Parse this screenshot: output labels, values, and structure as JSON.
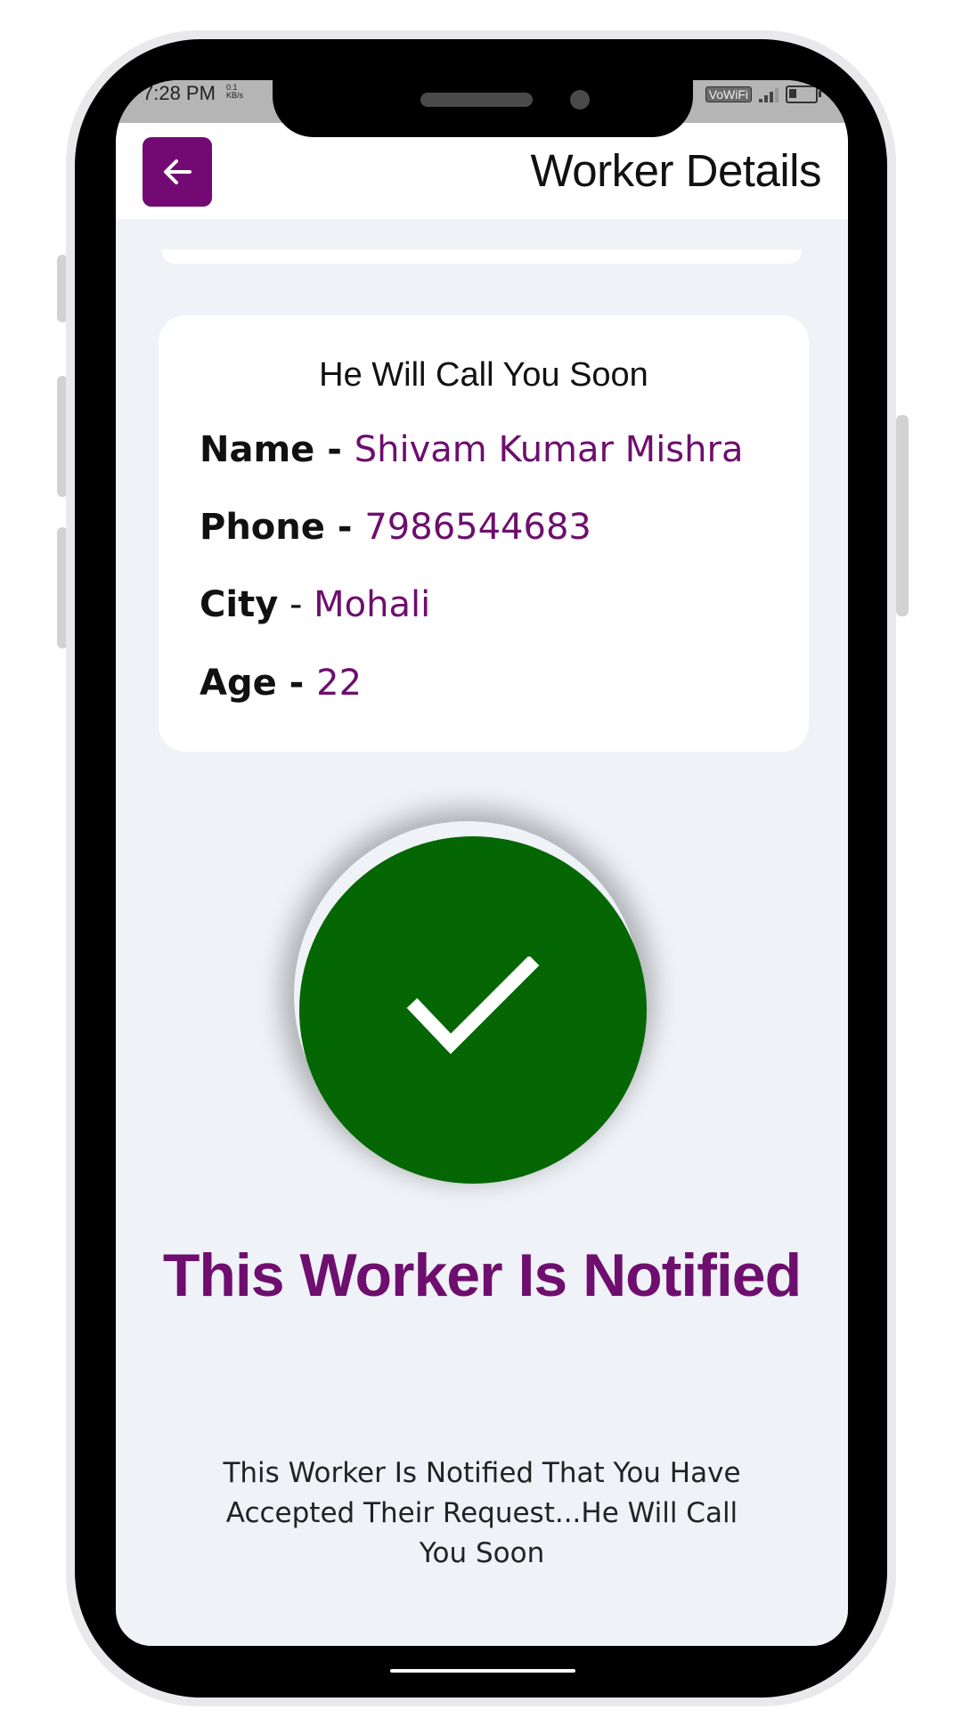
{
  "status_bar": {
    "time": "7:28 PM",
    "net_speed": "0.1 KB/s",
    "vowifi": "VoWiFi"
  },
  "header": {
    "title": "Worker Details"
  },
  "card": {
    "heading": "He Will Call You Soon",
    "rows": [
      {
        "label": "Name",
        "value": "Shivam Kumar Mishra"
      },
      {
        "label": "Phone",
        "value": "7986544683"
      },
      {
        "label": "City",
        "value": "Mohali"
      },
      {
        "label": "Age",
        "value": "22"
      }
    ],
    "separator": " - "
  },
  "success": {
    "title": "This Worker Is Notified",
    "description": "This Worker Is Notified That You Have Accepted Their Request...He Will Call You Soon"
  },
  "icons": {
    "back": "arrow-left-icon",
    "check": "checkmark-icon"
  },
  "colors": {
    "accent": "#730a73",
    "value_text": "#6e0e6e",
    "success_green": "#046704",
    "screen_bg": "#eff2f7"
  }
}
